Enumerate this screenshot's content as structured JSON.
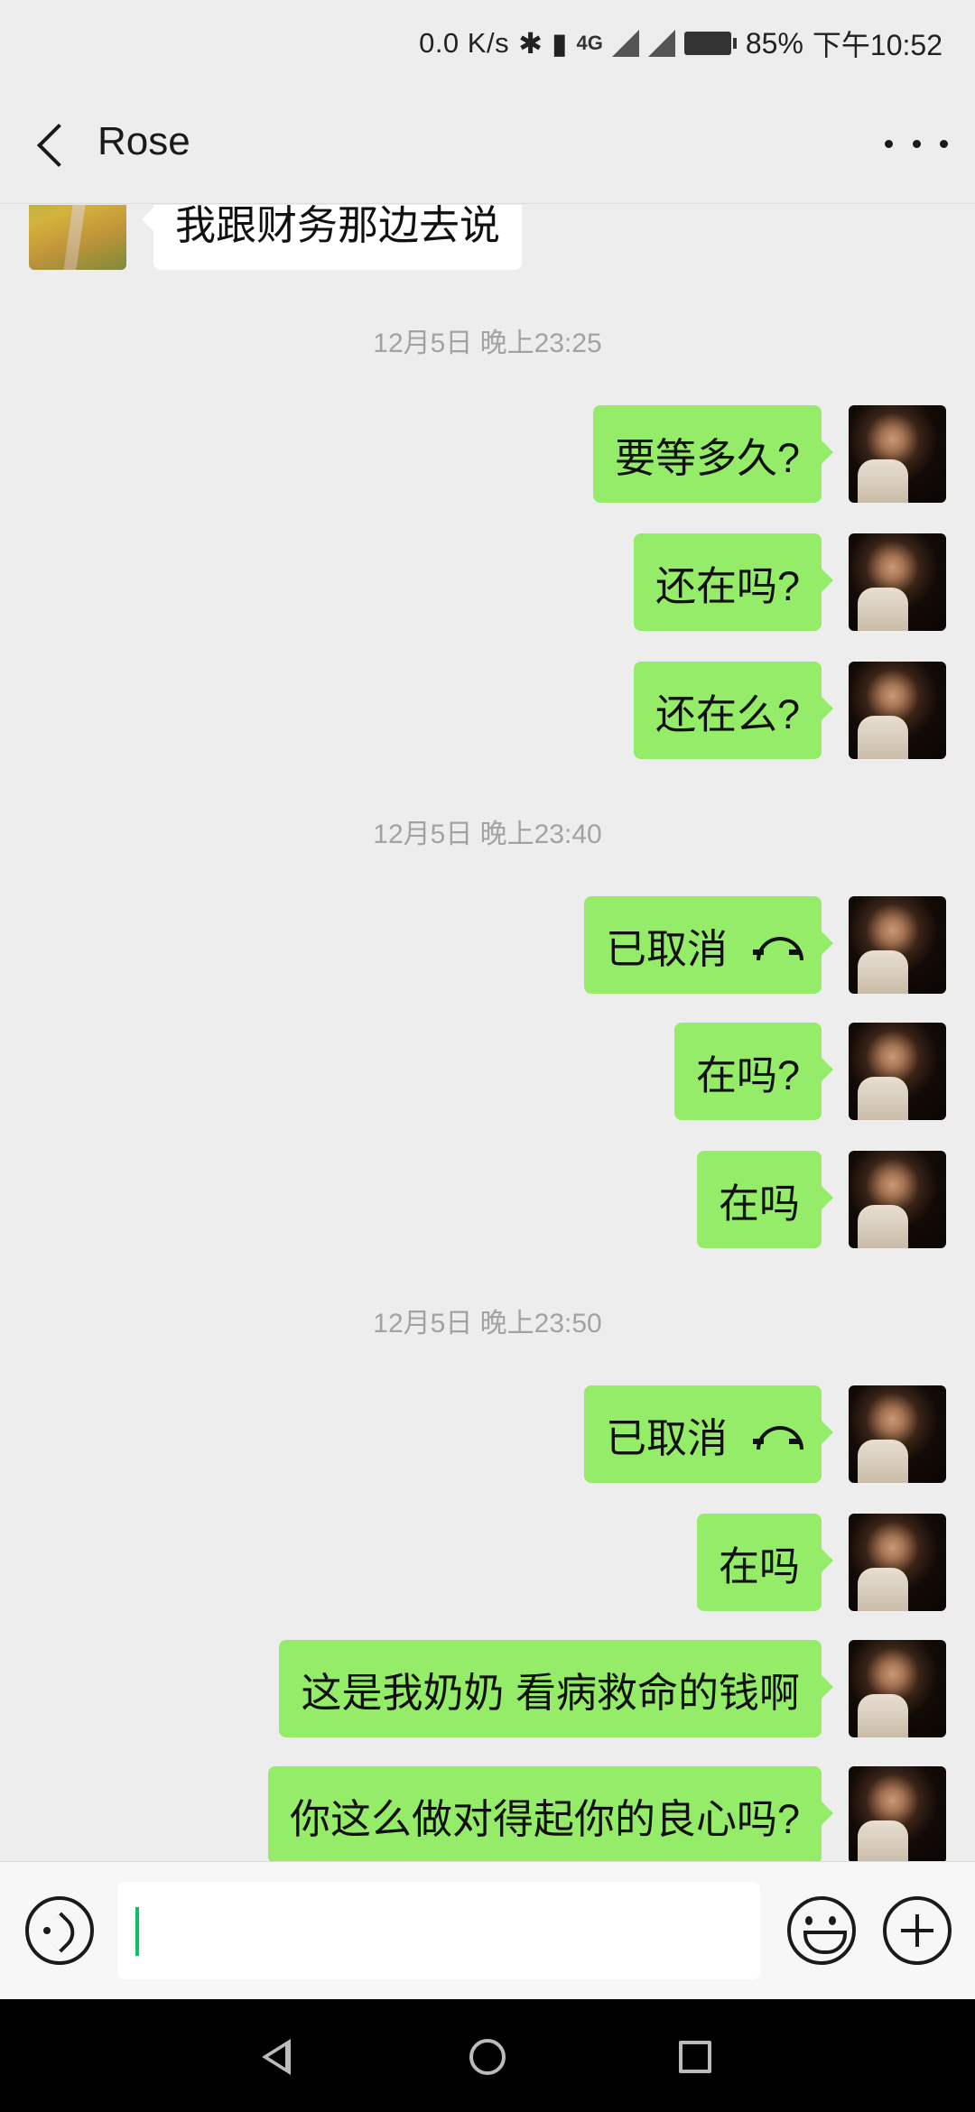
{
  "status_bar": {
    "net_speed": "0.0 K/s",
    "network_type": "4G",
    "battery": "85%",
    "time": "下午10:52"
  },
  "header": {
    "title": "Rose",
    "back_icon": "chevron-left-icon",
    "more_icon": "more-dots-icon"
  },
  "messages": {
    "m0": "我跟财务那边去说",
    "t1": "12月5日 晚上23:25",
    "m1": "要等多久?",
    "m2": "还在吗?",
    "m3": "还在么?",
    "t2": "12月5日 晚上23:40",
    "m4": "已取消",
    "m5": "在吗?",
    "m6": "在吗",
    "t3": "12月5日 晚上23:50",
    "m7": "已取消",
    "m8": "在吗",
    "m9": "这是我奶奶  看病救命的钱啊",
    "m10": "你这么做对得起你的良心吗?"
  },
  "colors": {
    "self_bubble": "#95ec69",
    "other_bubble": "#ffffff",
    "background": "#ededed",
    "caret": "#07c160"
  },
  "input_bar": {
    "voice_icon": "voice-icon",
    "emoji_icon": "emoji-icon",
    "plus_icon": "plus-icon"
  }
}
